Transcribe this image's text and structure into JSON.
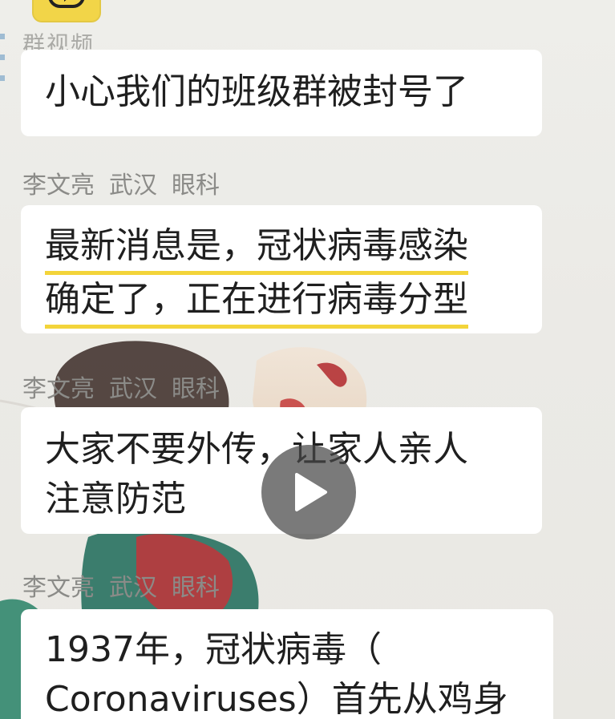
{
  "header": {
    "app_icon": "video-app-icon",
    "section_label": "群视频"
  },
  "messages": [
    {
      "sender": null,
      "text_lines": [
        "小心我们的班级群被封号了"
      ],
      "highlighted": false
    },
    {
      "sender": {
        "name": "李文亮",
        "city": "武汉",
        "dept": "眼科"
      },
      "text_lines": [
        "最新消息是，冠状病毒感染",
        "确定了，正在进行病毒分型"
      ],
      "highlighted": true,
      "highlight_color": "#f3d43a"
    },
    {
      "sender": {
        "name": "李文亮",
        "city": "武汉",
        "dept": "眼科"
      },
      "text_lines": [
        "大家不要外传，让家人亲人",
        "注意防范"
      ],
      "highlighted": false
    },
    {
      "sender": {
        "name": "李文亮",
        "city": "武汉",
        "dept": "眼科"
      },
      "text_lines": [
        "1937年，冠状病毒（",
        "Coronaviruses）首先从鸡身"
      ],
      "highlighted": false
    }
  ],
  "player": {
    "play_icon": "play-icon"
  }
}
